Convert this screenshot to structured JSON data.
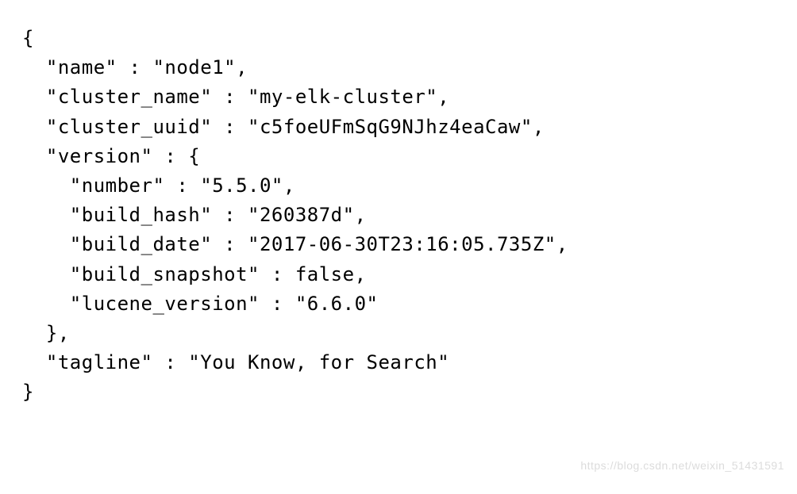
{
  "lines": [
    "{",
    "  \"name\" : \"node1\",",
    "  \"cluster_name\" : \"my-elk-cluster\",",
    "  \"cluster_uuid\" : \"c5foeUFmSqG9NJhz4eaCaw\",",
    "  \"version\" : {",
    "    \"number\" : \"5.5.0\",",
    "    \"build_hash\" : \"260387d\",",
    "    \"build_date\" : \"2017-06-30T23:16:05.735Z\",",
    "    \"build_snapshot\" : false,",
    "    \"lucene_version\" : \"6.6.0\"",
    "  },",
    "  \"tagline\" : \"You Know, for Search\"",
    "}"
  ],
  "watermark": "https://blog.csdn.net/weixin_51431591"
}
